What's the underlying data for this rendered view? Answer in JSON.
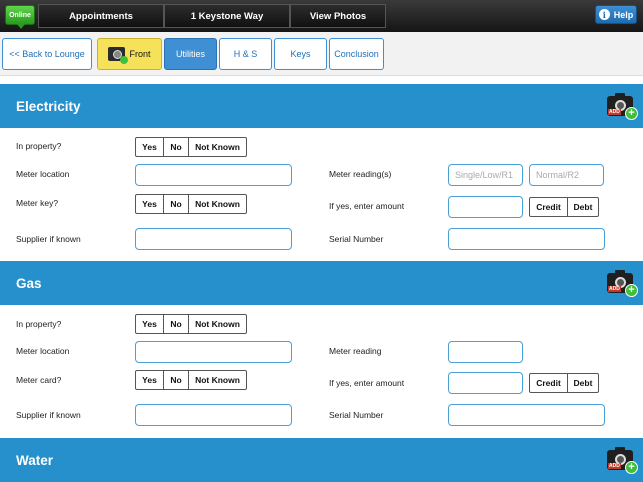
{
  "topbar": {
    "online_label": "Online",
    "tabs": [
      "Appointments",
      "1 Keystone Way",
      "View Photos"
    ],
    "help_label": "Help",
    "help_icon_glyph": "i"
  },
  "subnav": {
    "back_label": "<< Back to Lounge",
    "tabs": [
      "Front",
      "Utilities",
      "H & S",
      "Keys",
      "Conclusion"
    ],
    "active_tab": "Utilities"
  },
  "add_photo_label": "ADD",
  "add_photo_plus": "+",
  "segment_options": [
    "Yes",
    "No",
    "Not Known"
  ],
  "credit_debt": [
    "Credit",
    "Debt"
  ],
  "electricity": {
    "title": "Electricity",
    "in_property": "In property?",
    "meter_location": "Meter location",
    "meter_key": "Meter key?",
    "supplier": "Supplier if known",
    "meter_readings": "Meter reading(s)",
    "reading1_placeholder": "Single/Low/R1",
    "reading2_placeholder": "Normal/R2",
    "if_yes_amount": "If yes, enter amount",
    "serial_number": "Serial Number"
  },
  "gas": {
    "title": "Gas",
    "in_property": "In property?",
    "meter_location": "Meter location",
    "meter_card": "Meter card?",
    "supplier": "Supplier if known",
    "meter_reading": "Meter reading",
    "if_yes_amount": "If yes, enter amount",
    "serial_number": "Serial Number"
  },
  "water": {
    "title": "Water"
  },
  "colors": {
    "section_blue": "#2590cc",
    "active_tab_blue": "#3f8fd4",
    "front_tab_yellow": "#f6e15a",
    "online_green": "#3fbf3a"
  }
}
